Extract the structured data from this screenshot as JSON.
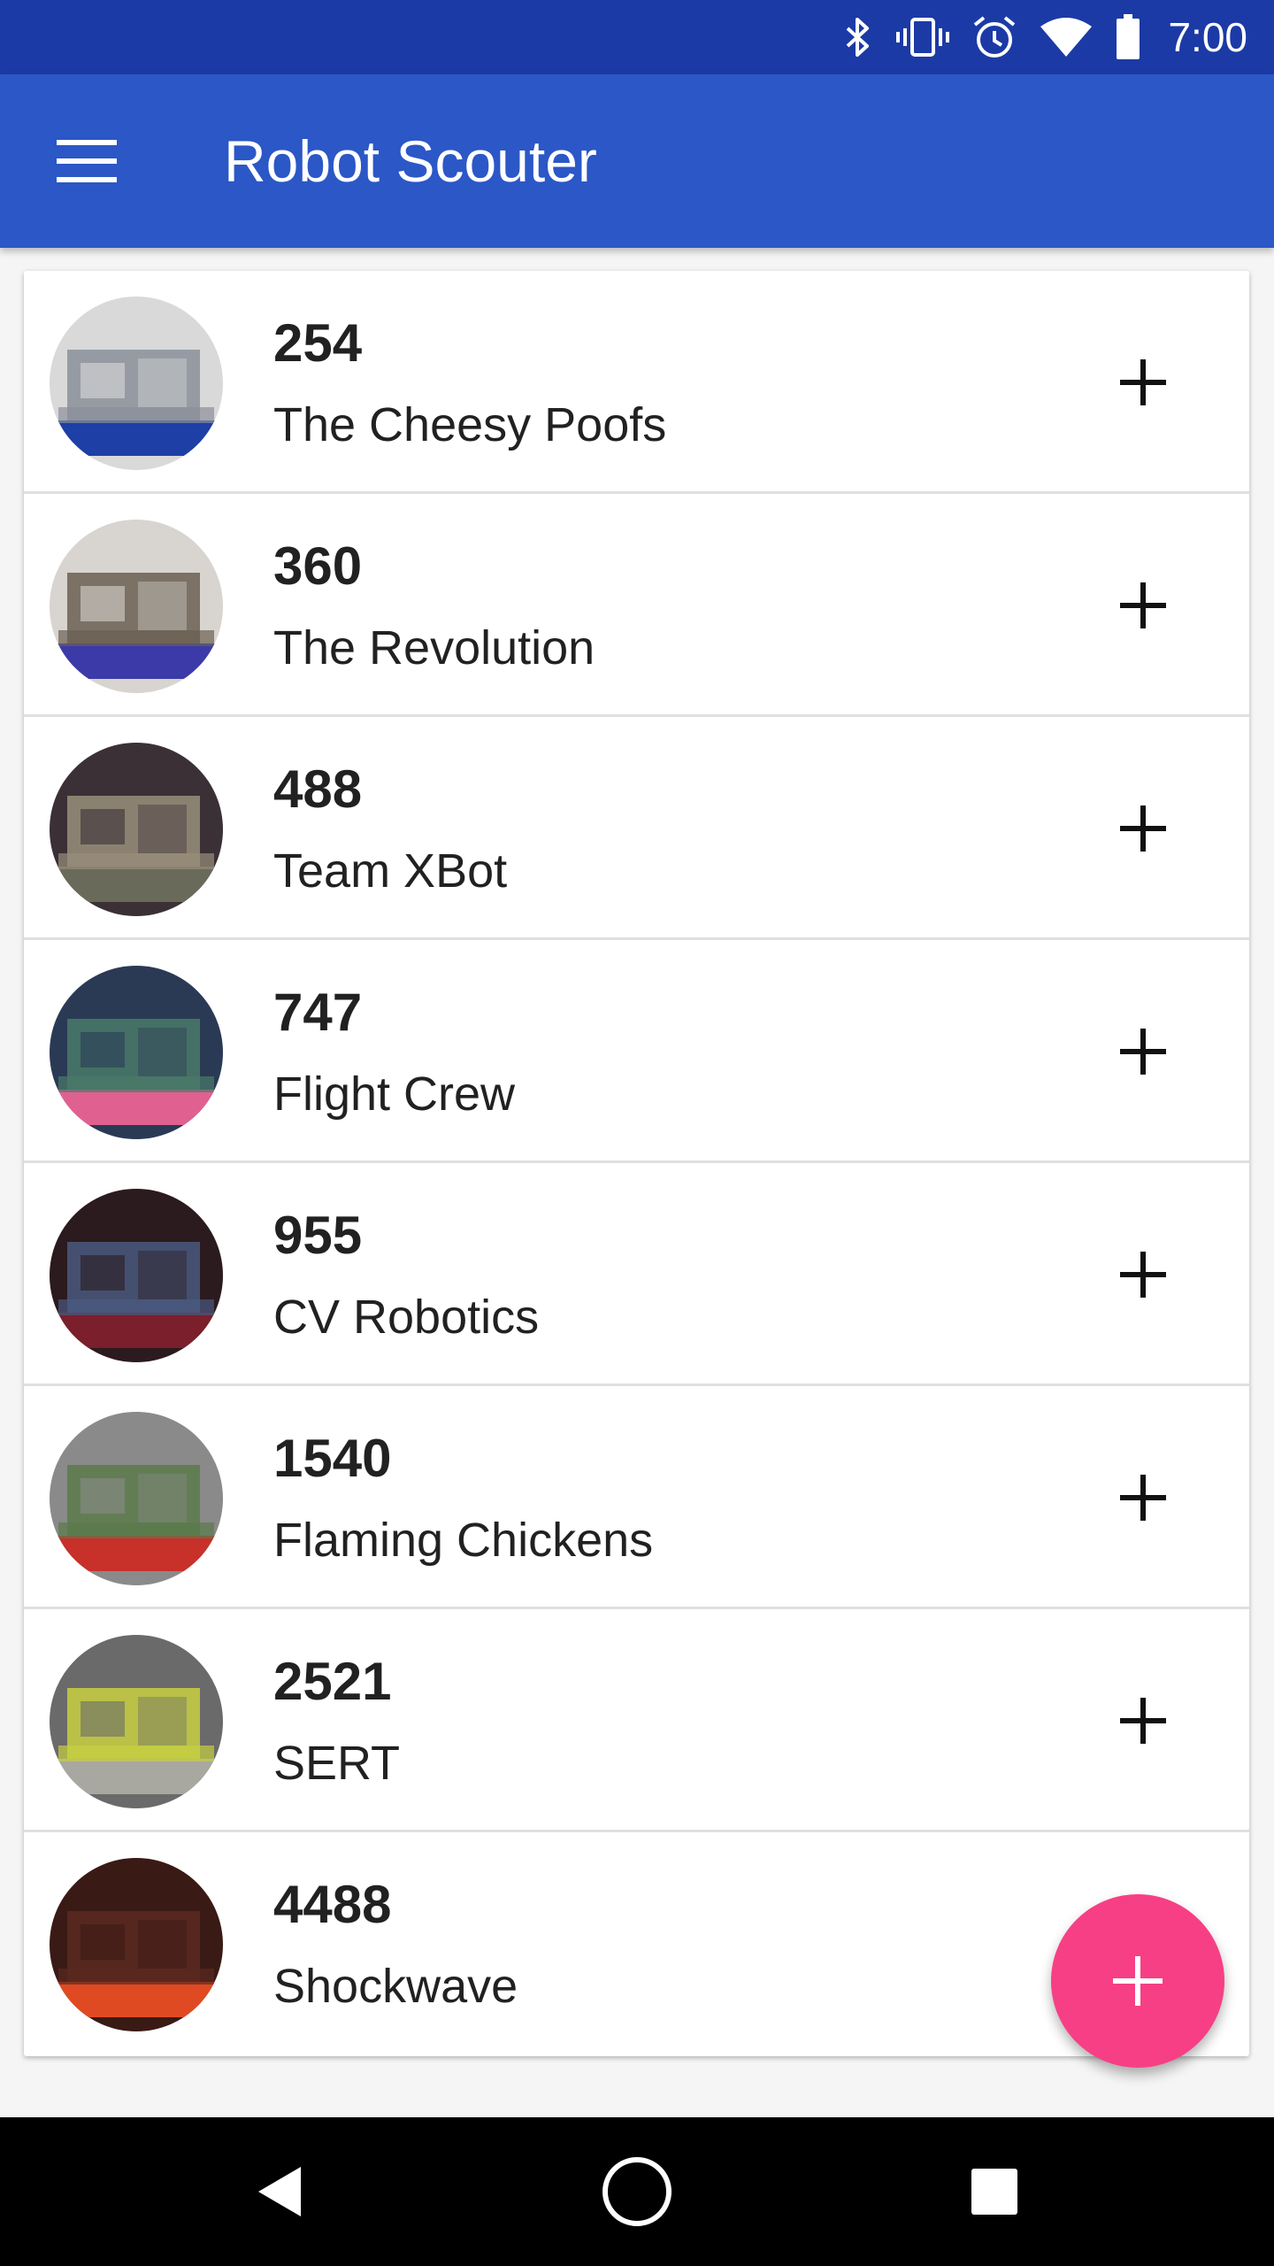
{
  "status_bar": {
    "time": "7:00",
    "icons": [
      "bluetooth-icon",
      "vibrate-icon",
      "alarm-icon",
      "wifi-icon",
      "battery-icon"
    ]
  },
  "app_bar": {
    "title": "Robot Scouter",
    "menu_icon": "menu-icon",
    "color": "#2b57c7"
  },
  "teams": [
    {
      "number": "254",
      "name": "The Cheesy Poofs",
      "colors": [
        "#d9d9d9",
        "#1d3fa6",
        "#8a8f99"
      ]
    },
    {
      "number": "360",
      "name": "The Revolution",
      "colors": [
        "#d8d4cf",
        "#3b3aa8",
        "#6b5f52"
      ]
    },
    {
      "number": "488",
      "name": "Team XBot",
      "colors": [
        "#3a3036",
        "#6a6a5a",
        "#9a8f7a"
      ]
    },
    {
      "number": "747",
      "name": "Flight Crew",
      "colors": [
        "#2a3a55",
        "#e0618f",
        "#4a7a6a"
      ]
    },
    {
      "number": "955",
      "name": "CV Robotics",
      "colors": [
        "#2b1a1e",
        "#7a1f2b",
        "#4a5a80"
      ]
    },
    {
      "number": "1540",
      "name": "Flaming Chickens",
      "colors": [
        "#8a8a8a",
        "#c8302a",
        "#5a7a4a"
      ]
    },
    {
      "number": "2521",
      "name": "SERT",
      "colors": [
        "#6a6a6a",
        "#a8a8a0",
        "#c8d040"
      ]
    },
    {
      "number": "4488",
      "name": "Shockwave",
      "colors": [
        "#3a1a14",
        "#e04a22",
        "#5a2a20"
      ]
    }
  ],
  "fab": {
    "icon": "plus-icon",
    "color": "#f73f85"
  },
  "nav_bar": {
    "icons": [
      "back-icon",
      "home-icon",
      "recents-icon"
    ]
  }
}
